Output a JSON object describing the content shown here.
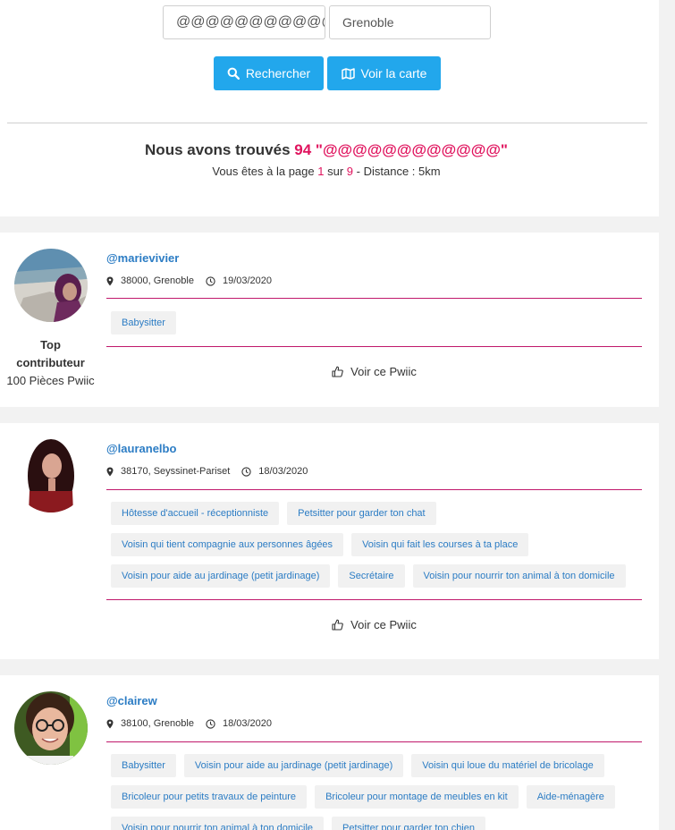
{
  "search": {
    "query_value": "@@@@@@@@@@@@",
    "city_value": "Grenoble",
    "search_label": "Rechercher",
    "map_label": "Voir la carte"
  },
  "results": {
    "prefix": "Nous avons trouvés",
    "count": "94",
    "query_quoted": "\"@@@@@@@@@@@@\"",
    "page_prefix": "Vous êtes à la page",
    "page_current": "1",
    "page_of": "sur",
    "page_total": "9",
    "distance": "- Distance : 5km"
  },
  "cards": [
    {
      "username": "@marievivier",
      "location": "38000, Grenoble",
      "date": "19/03/2020",
      "badge_title_1": "Top",
      "badge_title_2": "contributeur",
      "badge_points": "100 Pièces Pwiic",
      "tags": [
        "Babysitter"
      ],
      "view_label": "Voir ce Pwiic"
    },
    {
      "username": "@lauranelbo",
      "location": "38170, Seyssinet-Pariset",
      "date": "18/03/2020",
      "tags": [
        "Hôtesse d'accueil - réceptionniste",
        "Petsitter pour garder ton chat",
        "Voisin qui tient compagnie aux personnes âgées",
        "Voisin qui fait les courses à ta place",
        "Voisin pour aide au jardinage (petit jardinage)",
        "Secrétaire",
        "Voisin pour nourrir ton animal à ton domicile"
      ],
      "view_label": "Voir ce Pwiic"
    },
    {
      "username": "@clairew",
      "location": "38100, Grenoble",
      "date": "18/03/2020",
      "tags": [
        "Babysitter",
        "Voisin pour aide au jardinage (petit jardinage)",
        "Voisin qui loue du matériel de bricolage",
        "Bricoleur pour petits travaux de peinture",
        "Bricoleur pour montage de meubles en kit",
        "Aide-ménagère",
        "Voisin pour nourrir ton animal à ton domicile",
        "Petsitter pour garder ton chien"
      ]
    }
  ],
  "colors": {
    "accent_blue": "#22a7ec",
    "link_blue": "#2b7cc4",
    "highlight_pink": "#e0145e",
    "separator": "#c0186b"
  }
}
